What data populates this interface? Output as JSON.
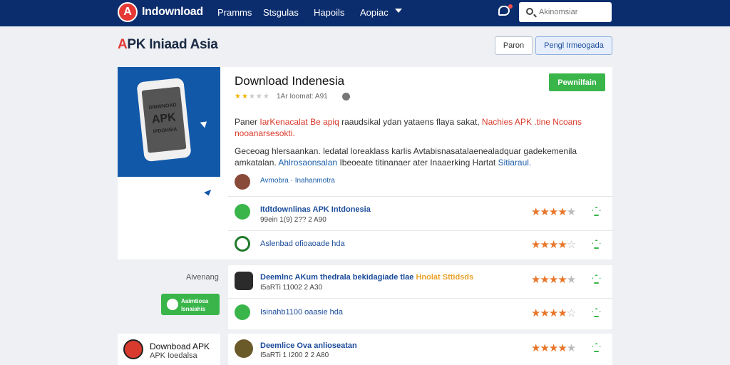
{
  "header": {
    "brand": "Indownload",
    "nav": [
      "Pramms",
      "Stsgulas",
      "Hapoils",
      "Aopiac"
    ],
    "search_placeholder": "Akinomsiar",
    "colors": {
      "bar": "#0b2d6e",
      "logo": "#e53935"
    }
  },
  "page": {
    "title_accent": "A",
    "title_rest": "PK Iniaad Asia",
    "btn_1": "Paron",
    "btn_2": "Pengl Irmeogada"
  },
  "app": {
    "title": "Download Indenesia",
    "rating": 2,
    "meta": "1Ar Ioomat: A91",
    "download_label": "Pewnilfain",
    "para1_a": "Paner ",
    "para1_b": "IarKenacalat Be apiq",
    "para1_c": " raaudsikal ydan yataens flaya sakat,  ",
    "para1_d": "Nachies APK .tine Ncoans nooanarsesokti.",
    "para2_a": "Geceoag hlersaankan. ledatal loreaklass karlis Avtabisnasatalaenealadquar gadekemenila amkatalan. ",
    "para2_b": "Ahlrosaonsalan",
    "para2_c": " Ibeoeate titinanaer ater Inaaerking Hartat ",
    "para2_d": "Sitiaraul.",
    "author": "Avmobra · Inahanmotra",
    "hero_text_top": "DINWNOAD",
    "hero_text_mid": "APK",
    "hero_text_bot": "IPDOHSIA"
  },
  "list": [
    {
      "title": "Itdtdownlinas APK Intdonesia",
      "sub": "99ein 1(9) 2?? 2 A90",
      "rating": 4.5,
      "icon_color": "#3ab54a"
    },
    {
      "title": "Aslenbad ofioaoade hda",
      "sub": "",
      "rating": 4,
      "icon_color": "#1f7a2a"
    }
  ],
  "sidebar": {
    "label": "Aivenang",
    "card_line1": "Aaimtiosa",
    "card_line2": "Isnaiahis"
  },
  "list2": [
    {
      "title": "Deemlnc AKum thedrala bekidagiade tlae",
      "title_extra": "Hnolat Sttidsds",
      "sub": "I5aRTi 11002 2 A30",
      "rating": 4.5,
      "icon_color": "#2b2b2b"
    },
    {
      "title": "Isinahb1100 oaasie hda",
      "sub": "",
      "rating": 4,
      "icon_color": "#3ab54a"
    },
    {
      "title": "Deemlice Ova anlioseatan",
      "sub": "I5aRTi 1  I200 2 2 A80",
      "rating": 4.5,
      "icon_color": "#6a5a2a"
    }
  ],
  "bottom_card": {
    "title": "Downboad APK",
    "sub": "APK Ioedalsa"
  }
}
